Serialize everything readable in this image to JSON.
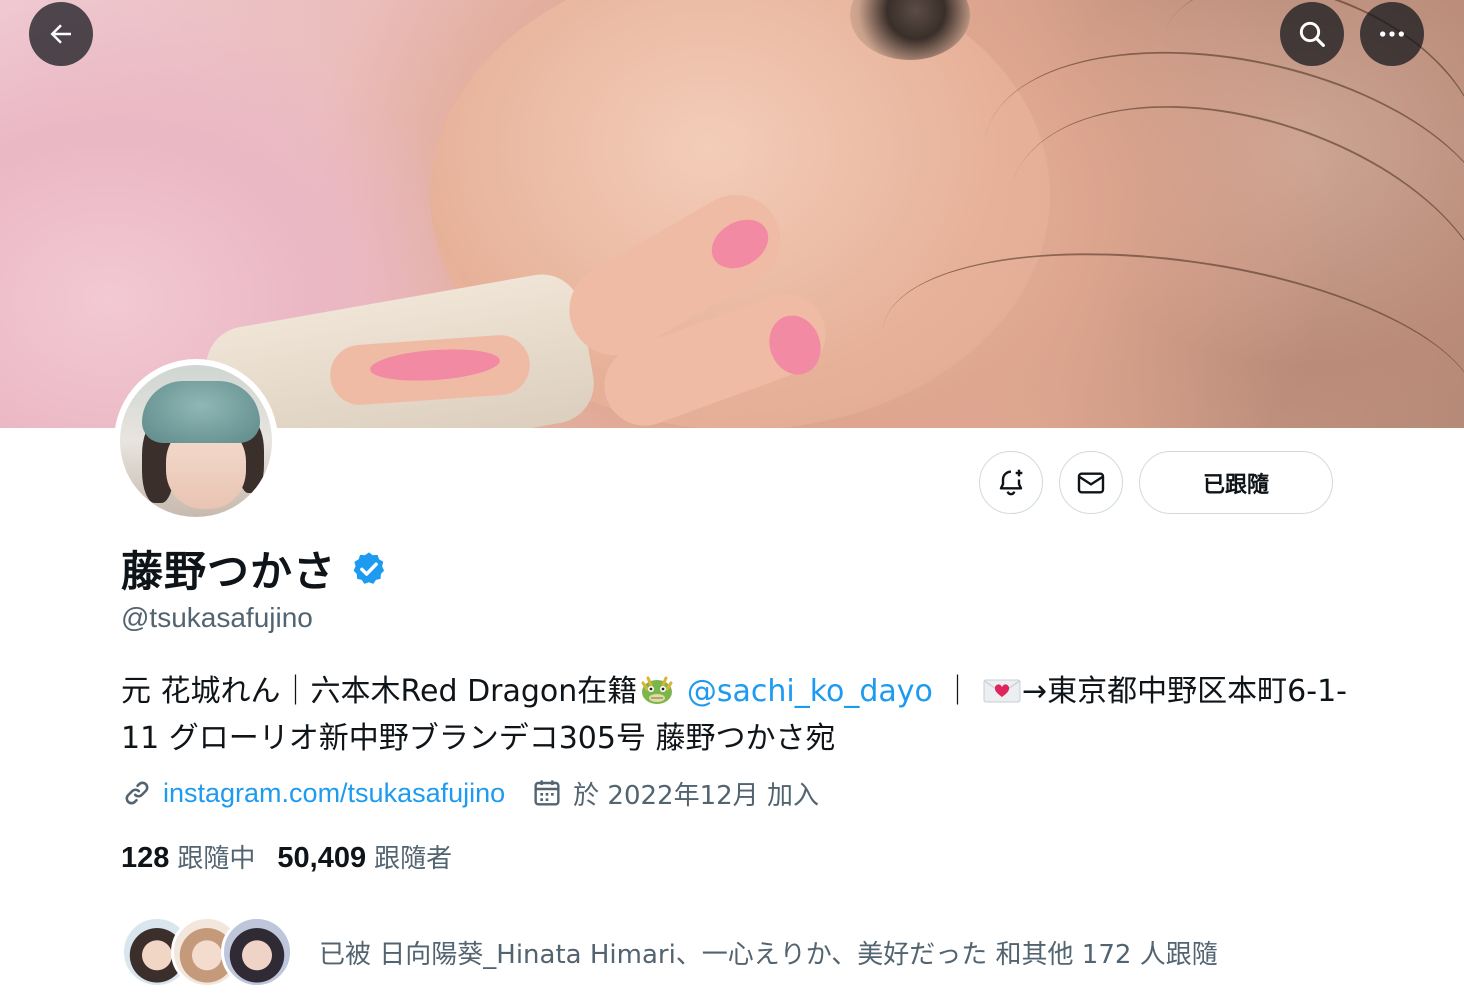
{
  "header": {
    "back_icon": "arrow-left-icon",
    "search_icon": "search-icon",
    "more_icon": "more-horizontal-icon"
  },
  "profile": {
    "display_name": "藤野つかさ",
    "verified": true,
    "handle": "@tsukasafujino",
    "bio": {
      "part1": "元 花城れん｜六本木Red Dragon在籍",
      "emoji1": "dragon-face-emoji",
      "mention": "@sachi_ko_dayo",
      "part2": "｜",
      "emoji2": "love-letter-emoji",
      "part3": "→東京都中野区本町6-1-11 グローリオ新中野ブランデコ305号 藤野つかさ宛"
    },
    "website": "instagram.com/tsukasafujino",
    "joined": "於 2022年12月 加入",
    "following_count": "128",
    "following_label": "跟隨中",
    "followers_count": "50,409",
    "followers_label": "跟隨者",
    "followed_by": "已被 日向陽葵_Hinata Himari、一心えりか、美好だった 和其他 172 人跟隨"
  },
  "actions": {
    "notify_icon": "bell-plus-icon",
    "message_icon": "mail-icon",
    "follow_label": "已跟隨"
  },
  "colors": {
    "accent": "#1d9bf0",
    "text_primary": "#0f1419",
    "text_secondary": "#536471",
    "border": "#cfd9de"
  }
}
